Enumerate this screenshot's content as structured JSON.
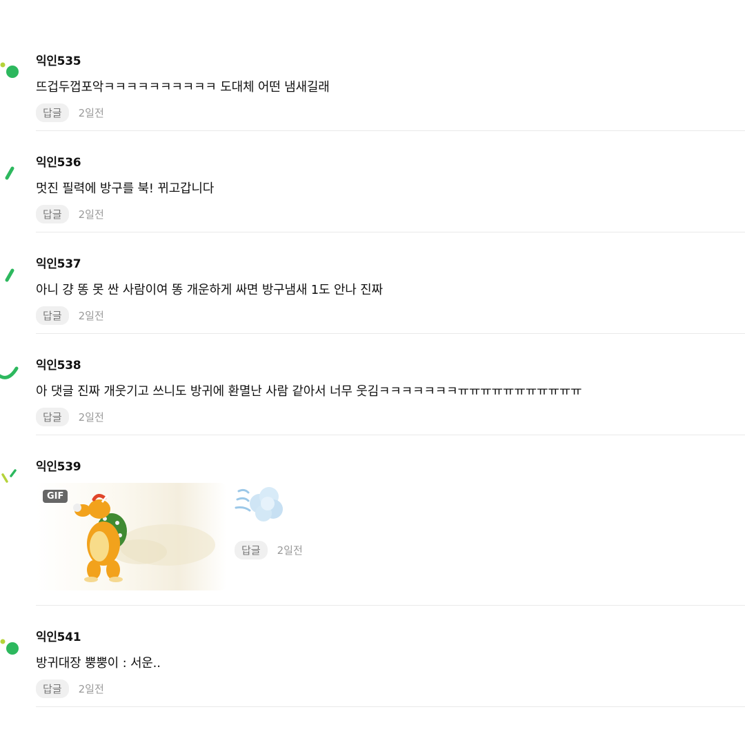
{
  "comments": [
    {
      "author": "익인535",
      "text": "뜨겁두껍포악ㅋㅋㅋㅋㅋㅋㅋㅋㅋㅋ 도대체 어떤 냄새길래",
      "reply": "답글",
      "time": "2일전"
    },
    {
      "author": "익인536",
      "text": "멋진 필력에 방구를 북! 뀌고갑니다",
      "reply": "답글",
      "time": "2일전"
    },
    {
      "author": "익인537",
      "text": "아니 걍 똥 못 싼 사람이여 똥 개운하게 싸면 방구냄새 1도 안나 진짜",
      "reply": "답글",
      "time": "2일전"
    },
    {
      "author": "익인538",
      "text": "아 댓글 진짜 개웃기고 쓰니도 방귀에 환멸난 사람 같아서 너무 웃김ㅋㅋㅋㅋㅋㅋㅋㅠㅠㅠㅠㅠㅠㅠㅠㅠㅠㅠ",
      "reply": "답글",
      "time": "2일전"
    },
    {
      "author": "익인539",
      "gif_badge": "GIF",
      "reply": "답글",
      "time": "2일전"
    },
    {
      "author": "익인541",
      "text": "방귀대장 뿡뿡이 : 서운..",
      "reply": "답글",
      "time": "2일전"
    }
  ],
  "colors": {
    "green": "#2db85e",
    "lime": "#b5d33a"
  }
}
